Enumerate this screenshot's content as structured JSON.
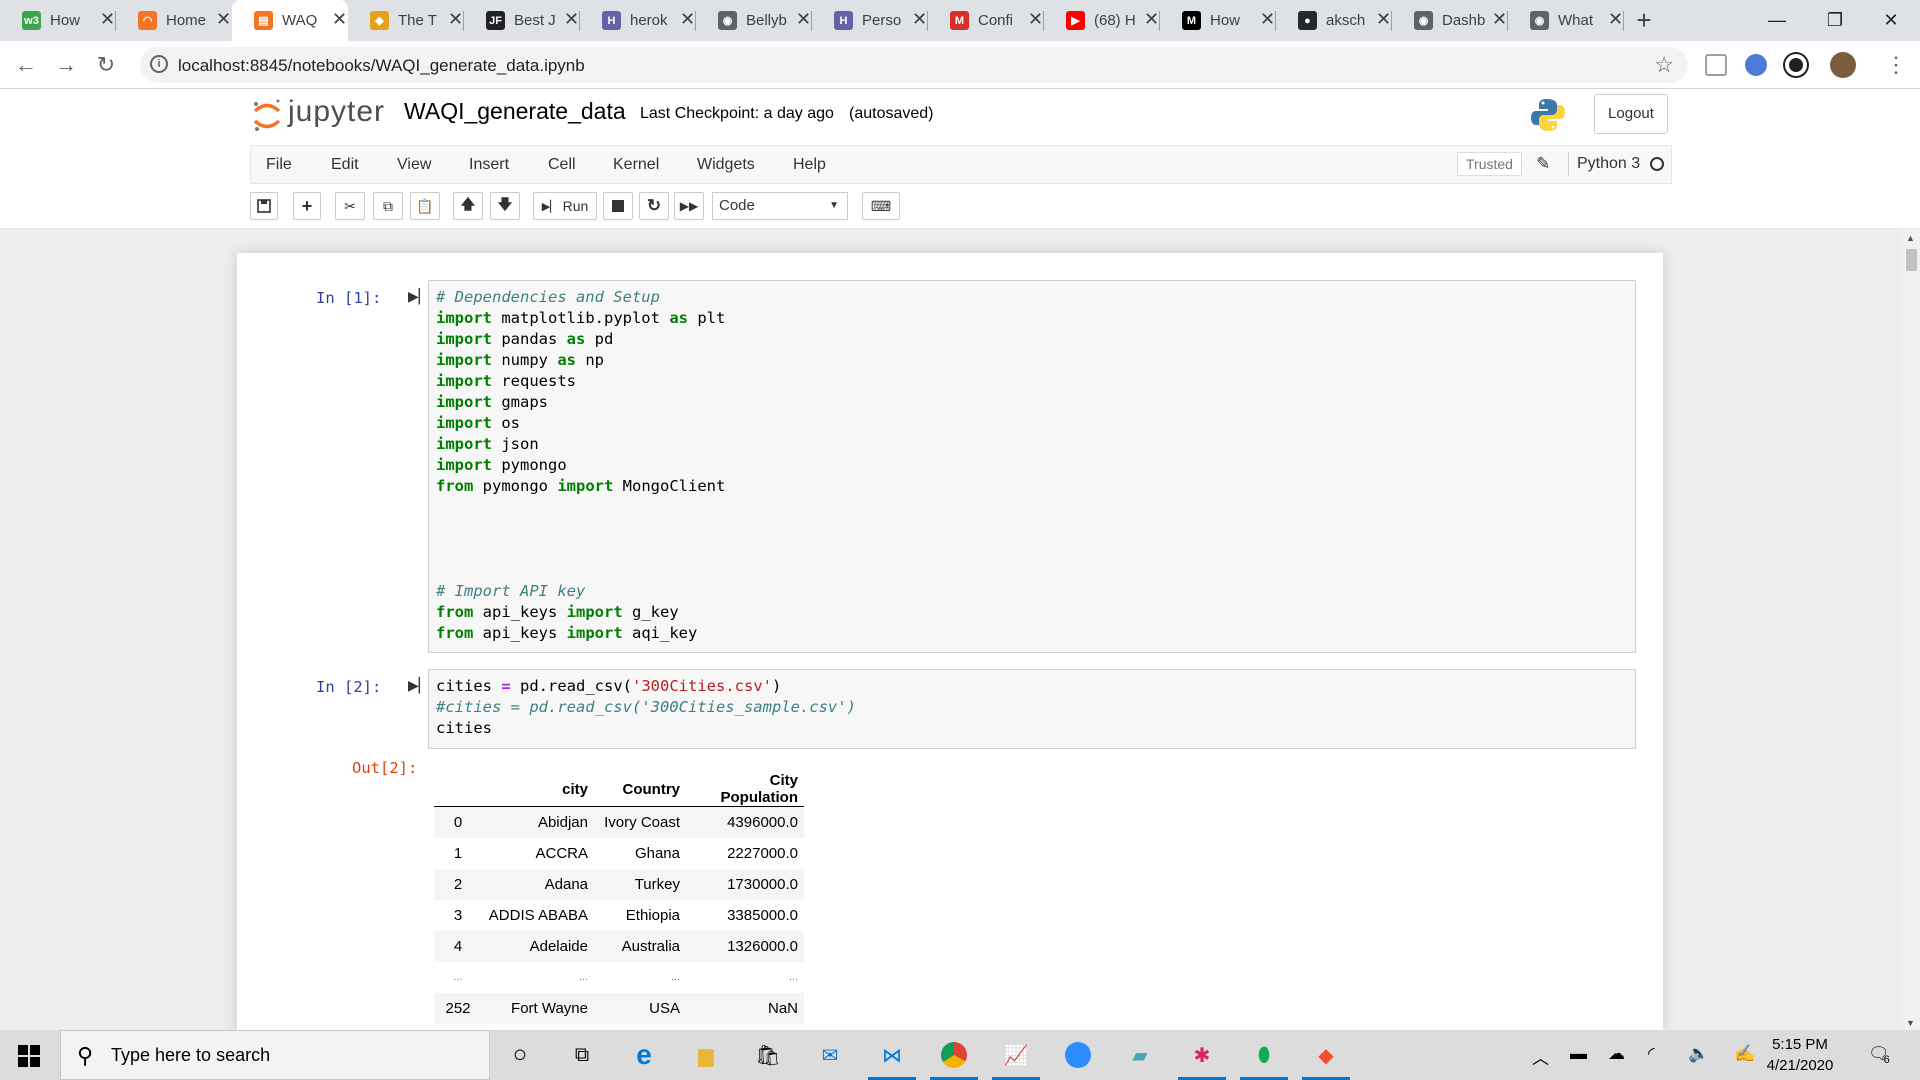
{
  "browser": {
    "tabs": [
      {
        "label": "How",
        "fav_color": "#3fa34d",
        "fav_glyph": "w3"
      },
      {
        "label": "Home",
        "fav_color": "#f37626",
        "fav_glyph": "◠"
      },
      {
        "label": "WAQ",
        "fav_color": "#f37626",
        "fav_glyph": "▤"
      },
      {
        "label": "The T",
        "fav_color": "#e3a21a",
        "fav_glyph": "◆"
      },
      {
        "label": "Best J",
        "fav_color": "#222222",
        "fav_glyph": "JF"
      },
      {
        "label": "herok",
        "fav_color": "#6762a6",
        "fav_glyph": "H"
      },
      {
        "label": "Bellyb",
        "fav_color": "#5f6368",
        "fav_glyph": "◉"
      },
      {
        "label": "Perso",
        "fav_color": "#6762a6",
        "fav_glyph": "H"
      },
      {
        "label": "Confi",
        "fav_color": "#d93025",
        "fav_glyph": "M"
      },
      {
        "label": "(68) H",
        "fav_color": "#ff0000",
        "fav_glyph": "▶"
      },
      {
        "label": "How",
        "fav_color": "#000000",
        "fav_glyph": "M"
      },
      {
        "label": "aksch",
        "fav_color": "#24292e",
        "fav_glyph": "●"
      },
      {
        "label": "Dashb",
        "fav_color": "#5f6368",
        "fav_glyph": "◉"
      },
      {
        "label": "What",
        "fav_color": "#5f6368",
        "fav_glyph": "◉"
      }
    ],
    "url": "localhost:8845/notebooks/WAQI_generate_data.ipynb"
  },
  "jupyter": {
    "logo_text": "jupyter",
    "notebook_name": "WAQI_generate_data",
    "checkpoint": "Last Checkpoint: a day ago",
    "autosave": "(autosaved)",
    "logout_label": "Logout",
    "menu": [
      "File",
      "Edit",
      "View",
      "Insert",
      "Cell",
      "Kernel",
      "Widgets",
      "Help"
    ],
    "trusted": "Trusted",
    "kernel_name": "Python 3",
    "run_label": "Run",
    "cell_type": "Code"
  },
  "cells": [
    {
      "prompt": "In [1]:",
      "lines": [
        [
          {
            "t": "# Dependencies and Setup",
            "c": "cm"
          }
        ],
        [
          {
            "t": "import",
            "c": "kw"
          },
          {
            "t": " matplotlib.pyplot ",
            "c": ""
          },
          {
            "t": "as",
            "c": "kw"
          },
          {
            "t": " plt",
            "c": ""
          }
        ],
        [
          {
            "t": "import",
            "c": "kw"
          },
          {
            "t": " pandas ",
            "c": ""
          },
          {
            "t": "as",
            "c": "kw"
          },
          {
            "t": " pd",
            "c": ""
          }
        ],
        [
          {
            "t": "import",
            "c": "kw"
          },
          {
            "t": " numpy ",
            "c": ""
          },
          {
            "t": "as",
            "c": "kw"
          },
          {
            "t": " np",
            "c": ""
          }
        ],
        [
          {
            "t": "import",
            "c": "kw"
          },
          {
            "t": " requests",
            "c": ""
          }
        ],
        [
          {
            "t": "import",
            "c": "kw"
          },
          {
            "t": " gmaps",
            "c": ""
          }
        ],
        [
          {
            "t": "import",
            "c": "kw"
          },
          {
            "t": " os",
            "c": ""
          }
        ],
        [
          {
            "t": "import",
            "c": "kw"
          },
          {
            "t": " json",
            "c": ""
          }
        ],
        [
          {
            "t": "import",
            "c": "kw"
          },
          {
            "t": " pymongo",
            "c": ""
          }
        ],
        [
          {
            "t": "from",
            "c": "kw"
          },
          {
            "t": " pymongo ",
            "c": ""
          },
          {
            "t": "import",
            "c": "kw"
          },
          {
            "t": " MongoClient",
            "c": ""
          }
        ],
        [],
        [],
        [],
        [],
        [
          {
            "t": "# Import API key",
            "c": "cm"
          }
        ],
        [
          {
            "t": "from",
            "c": "kw"
          },
          {
            "t": " api_keys ",
            "c": ""
          },
          {
            "t": "import",
            "c": "kw"
          },
          {
            "t": " g_key",
            "c": ""
          }
        ],
        [
          {
            "t": "from",
            "c": "kw"
          },
          {
            "t": " api_keys ",
            "c": ""
          },
          {
            "t": "import",
            "c": "kw"
          },
          {
            "t": " aqi_key",
            "c": ""
          }
        ]
      ]
    },
    {
      "prompt": "In [2]:",
      "lines": [
        [
          {
            "t": "cities ",
            "c": ""
          },
          {
            "t": "=",
            "c": "op"
          },
          {
            "t": " pd.read_csv(",
            "c": ""
          },
          {
            "t": "'300Cities.csv'",
            "c": "st"
          },
          {
            "t": ")",
            "c": ""
          }
        ],
        [
          {
            "t": "#cities = pd.read_csv('300Cities_sample.csv')",
            "c": "cm"
          }
        ],
        [
          {
            "t": "cities",
            "c": ""
          }
        ]
      ],
      "out_prompt": "Out[2]:"
    }
  ],
  "dataframe": {
    "columns": [
      "city",
      "Country",
      "City Population"
    ],
    "rows": [
      {
        "idx": "0",
        "city": "Abidjan",
        "country": "Ivory Coast",
        "pop": "4396000.0"
      },
      {
        "idx": "1",
        "city": "ACCRA",
        "country": "Ghana",
        "pop": "2227000.0"
      },
      {
        "idx": "2",
        "city": "Adana",
        "country": "Turkey",
        "pop": "1730000.0"
      },
      {
        "idx": "3",
        "city": "ADDIS ABABA",
        "country": "Ethiopia",
        "pop": "3385000.0"
      },
      {
        "idx": "4",
        "city": "Adelaide",
        "country": "Australia",
        "pop": "1326000.0"
      },
      {
        "idx": "...",
        "city": "...",
        "country": "...",
        "pop": "..."
      },
      {
        "idx": "252",
        "city": "Fort Wayne",
        "country": "USA",
        "pop": "NaN"
      }
    ]
  },
  "taskbar": {
    "search_placeholder": "Type here to search",
    "time": "5:15 PM",
    "date": "4/21/2020",
    "notifications": "6"
  }
}
